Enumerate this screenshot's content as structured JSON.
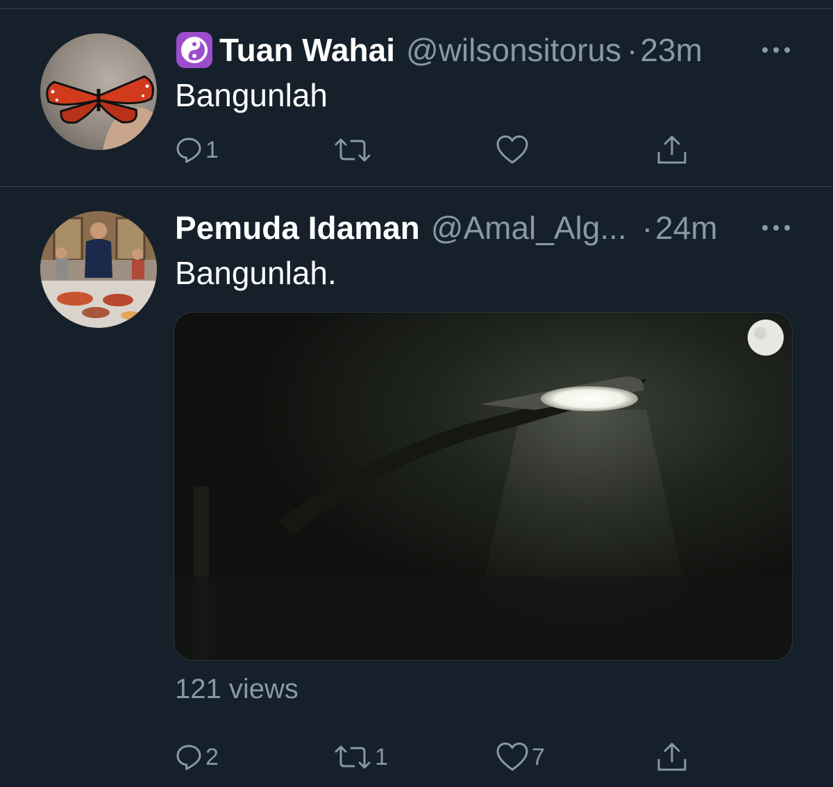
{
  "tweets": [
    {
      "display_name": "Tuan Wahai",
      "name_badge_icon": "yin-yang-icon",
      "handle": "@wilsonsitorus",
      "separator": "·",
      "time": "23m",
      "text": "Bangunlah",
      "avatar_icon": "butterfly-avatar",
      "replies": "1",
      "retweets": "",
      "likes": ""
    },
    {
      "display_name": "Pemuda Idaman",
      "handle": "@Amal_Alg...",
      "separator": "·",
      "time": "24m",
      "text": "Bangunlah.",
      "avatar_icon": "group-photo-avatar",
      "media_type": "video",
      "views": "121 views",
      "replies": "2",
      "retweets": "1",
      "likes": "7"
    }
  ],
  "colors": {
    "background": "#15202b",
    "secondary_text": "#8899a6",
    "divider": "#38444d",
    "badge_purple": "#9c4dcc"
  }
}
